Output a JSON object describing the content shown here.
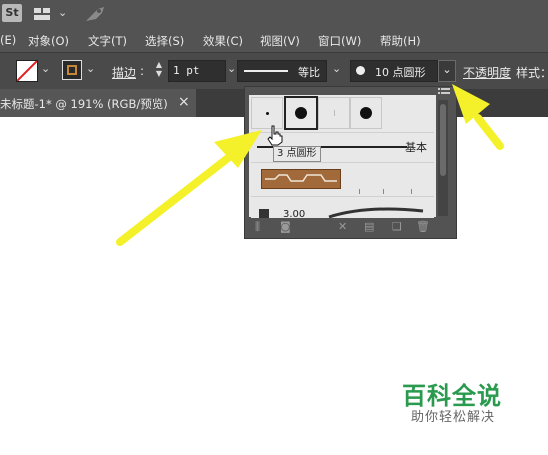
{
  "app": {
    "logo": "St",
    "layout_icon": "workspace-grid-icon",
    "extra_icon": "gpu-rocket-icon"
  },
  "menu": [
    "(E)",
    "对象(O)",
    "文字(T)",
    "选择(S)",
    "效果(C)",
    "视图(V)",
    "窗口(W)",
    "帮助(H)"
  ],
  "control": {
    "stroke_label": "描边",
    "stroke_value": "1 pt",
    "profile_label": "等比",
    "brush_value": "10 点圆形",
    "opacity_label": "不透明度",
    "style_label": "样式："
  },
  "document_tab": {
    "title": "未标题-1* @ 191% (RGB/预览)",
    "close": "×"
  },
  "brush_panel": {
    "tooltip": "3 点圆形",
    "basic_label": "基本",
    "stroke_weight": "3.00"
  },
  "watermark": {
    "title": "百科全说",
    "subtitle": "助你轻松解决"
  },
  "colors": {
    "ui_dark": "#535353",
    "arrow": "#f4f12a",
    "watermark": "#2a9a4e"
  }
}
